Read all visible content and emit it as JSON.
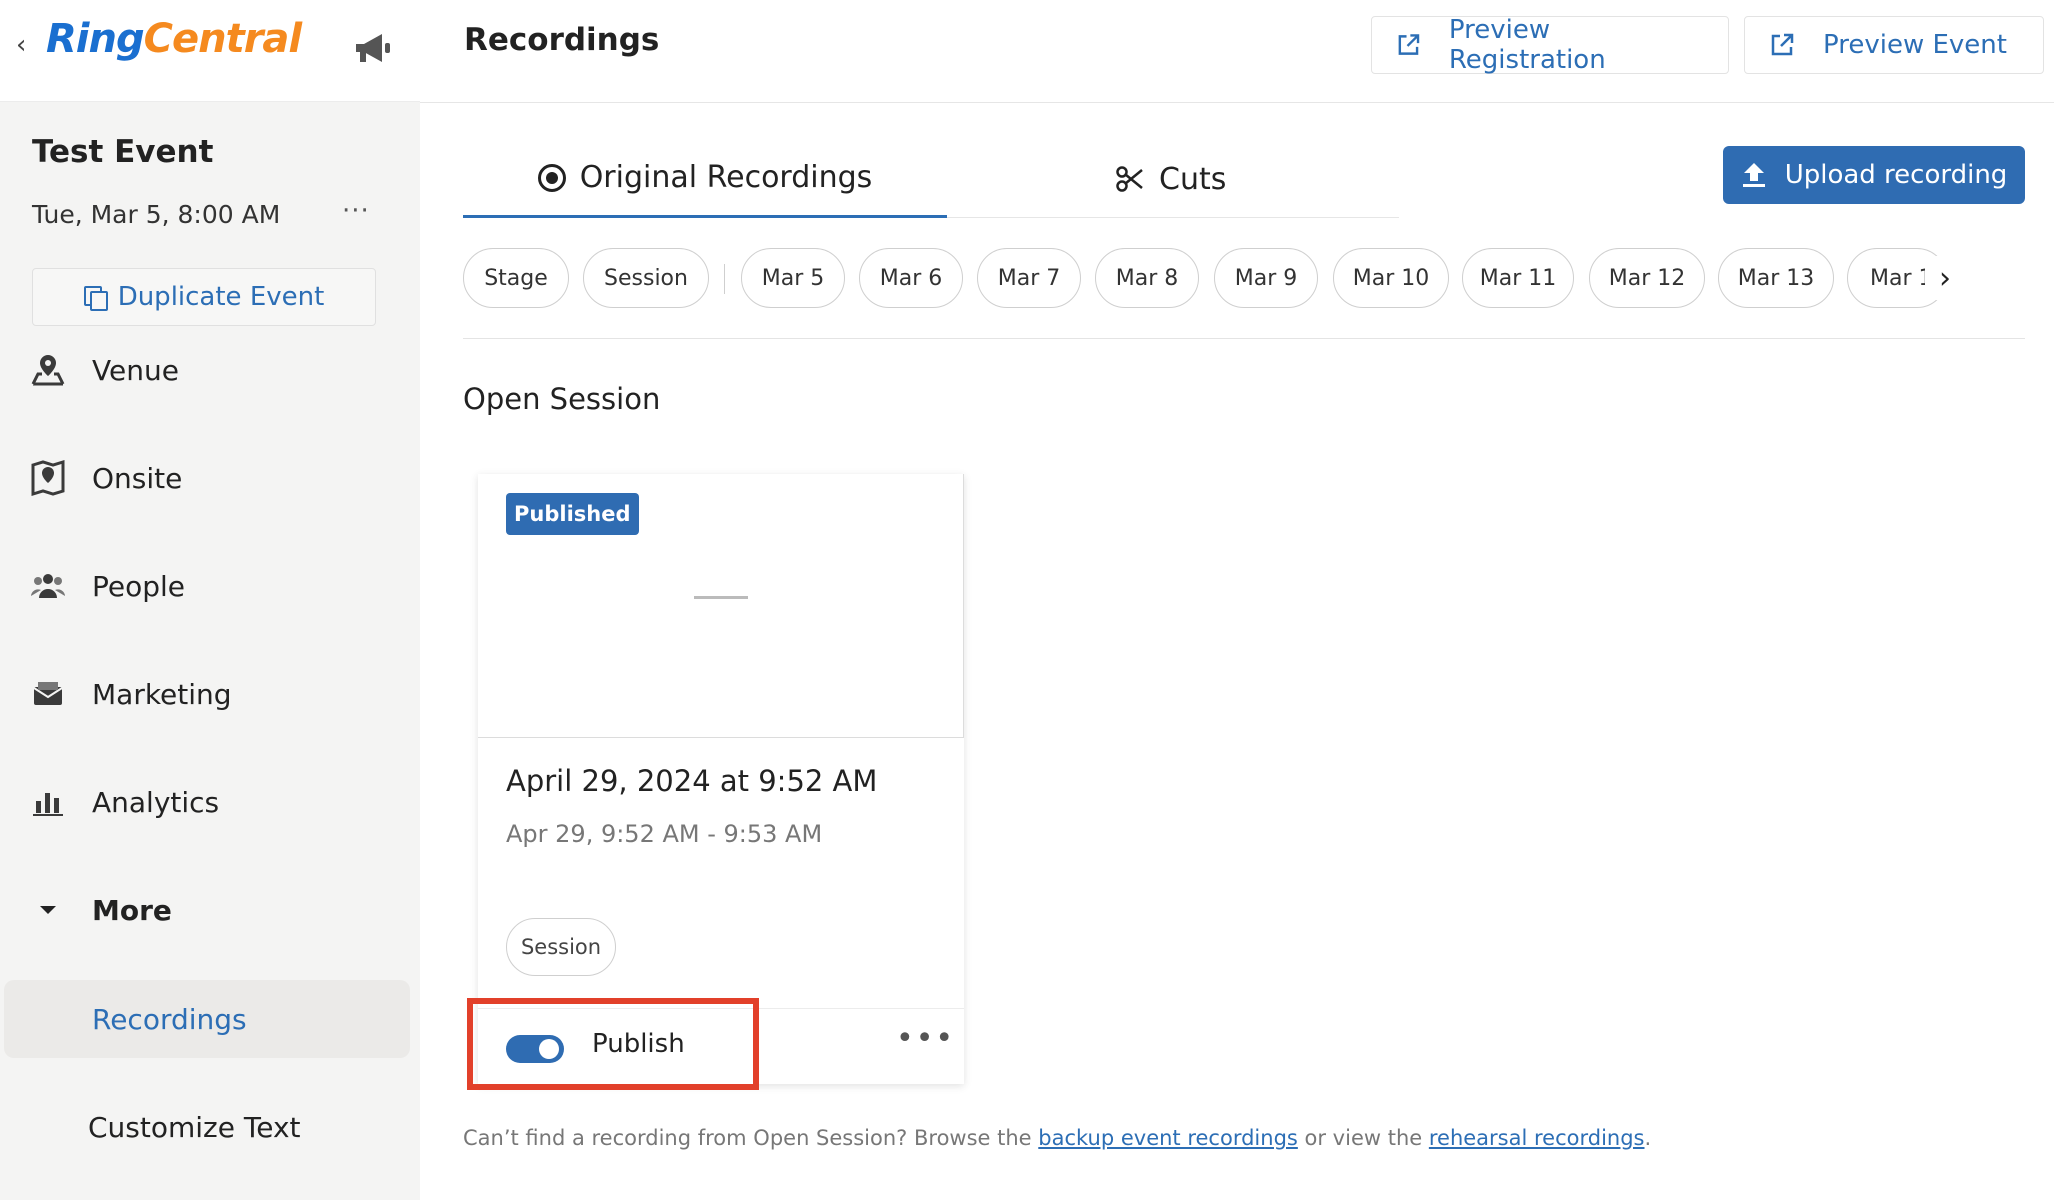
{
  "app": {
    "logo_ring": "Ring",
    "logo_central": "Central"
  },
  "sidebar": {
    "event_title": "Test Event",
    "event_date": "Tue, Mar 5, 8:00 AM",
    "event_more": "···",
    "duplicate_label": "Duplicate Event",
    "items": [
      {
        "label": "Venue",
        "icon": "venue-icon"
      },
      {
        "label": "Onsite",
        "icon": "onsite-map-icon"
      },
      {
        "label": "People",
        "icon": "people-icon"
      },
      {
        "label": "Marketing",
        "icon": "marketing-mail-icon"
      },
      {
        "label": "Analytics",
        "icon": "analytics-bar-icon"
      },
      {
        "label": "More",
        "icon": "caret-down-icon"
      }
    ],
    "sub_items": [
      {
        "label": "Recordings",
        "active": true
      },
      {
        "label": "Customize Text",
        "active": false
      }
    ]
  },
  "header": {
    "title": "Recordings",
    "preview_registration": "Preview Registration",
    "preview_event": "Preview Event"
  },
  "tabs": {
    "original": "Original Recordings",
    "cuts": "Cuts"
  },
  "upload_label": "Upload recording",
  "filters": [
    "Stage",
    "Session",
    "Mar 5",
    "Mar 6",
    "Mar 7",
    "Mar 8",
    "Mar 9",
    "Mar 10",
    "Mar 11",
    "Mar 12",
    "Mar 13",
    "Mar 1"
  ],
  "section_title": "Open Session",
  "card": {
    "badge": "Published",
    "title": "April 29, 2024 at 9:52 AM",
    "time_range": "Apr 29, 9:52 AM - 9:53 AM",
    "tag": "Session",
    "publish_label": "Publish",
    "publish_on": true,
    "more": "•••"
  },
  "footer": {
    "text_before": "Can’t find a recording from Open Session? Browse the ",
    "link_backup": "backup event recordings",
    "text_middle": " or view the ",
    "link_rehearsal": "rehearsal recordings",
    "text_end": "."
  },
  "colors": {
    "accent": "#2f6cb2",
    "highlight": "#e2402a",
    "logo_blue": "#1a6fd0",
    "logo_orange": "#f58a1f"
  }
}
